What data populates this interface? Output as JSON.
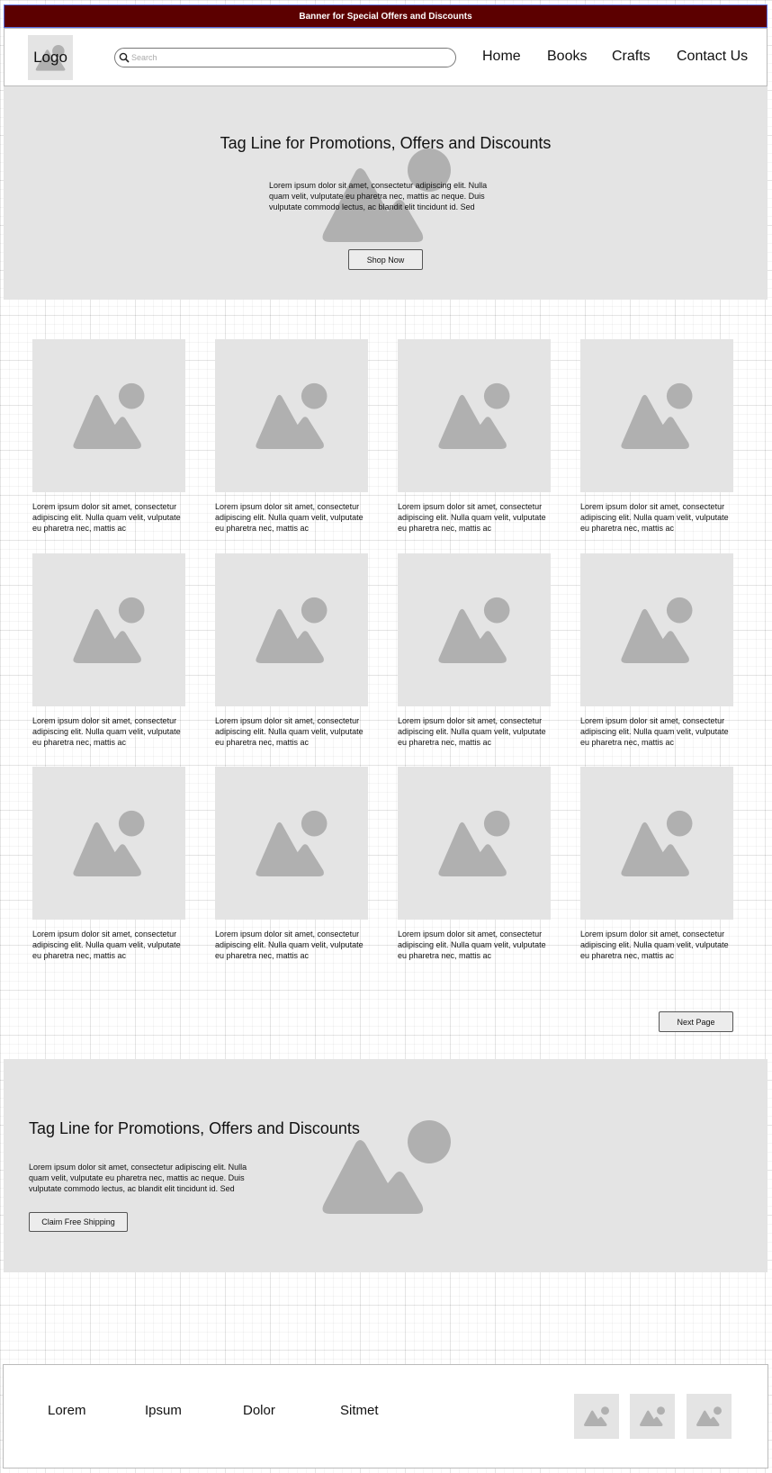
{
  "banner": {
    "text": "Banner for Special Offers and Discounts"
  },
  "header": {
    "logo": "Logo",
    "search": {
      "placeholder": "Search",
      "value": ""
    },
    "nav": [
      "Home",
      "Books",
      "Crafts",
      "Contact Us"
    ]
  },
  "hero": {
    "title": "Tag Line for Promotions, Offers and Discounts",
    "text": "Lorem ipsum dolor sit amet, consectetur adipiscing elit. Nulla quam velit, vulputate eu pharetra nec, mattis ac neque. Duis vulputate commodo lectus, ac blandit elit tincidunt id. Sed",
    "button": "Shop Now"
  },
  "products": [
    {
      "text": "Lorem ipsum dolor sit amet, consectetur adipiscing elit. Nulla quam velit, vulputate eu pharetra nec, mattis ac"
    },
    {
      "text": "Lorem ipsum dolor sit amet, consectetur adipiscing elit. Nulla quam velit, vulputate eu pharetra nec, mattis ac"
    },
    {
      "text": "Lorem ipsum dolor sit amet, consectetur adipiscing elit. Nulla quam velit, vulputate eu pharetra nec, mattis ac"
    },
    {
      "text": "Lorem ipsum dolor sit amet, consectetur adipiscing elit. Nulla quam velit, vulputate eu pharetra nec, mattis ac"
    },
    {
      "text": "Lorem ipsum dolor sit amet, consectetur adipiscing elit. Nulla quam velit, vulputate eu pharetra nec, mattis ac"
    },
    {
      "text": "Lorem ipsum dolor sit amet, consectetur adipiscing elit. Nulla quam velit, vulputate eu pharetra nec, mattis ac"
    },
    {
      "text": "Lorem ipsum dolor sit amet, consectetur adipiscing elit. Nulla quam velit, vulputate eu pharetra nec, mattis ac"
    },
    {
      "text": "Lorem ipsum dolor sit amet, consectetur adipiscing elit. Nulla quam velit, vulputate eu pharetra nec, mattis ac"
    },
    {
      "text": "Lorem ipsum dolor sit amet, consectetur adipiscing elit. Nulla quam velit, vulputate eu pharetra nec, mattis ac"
    },
    {
      "text": "Lorem ipsum dolor sit amet, consectetur adipiscing elit. Nulla quam velit, vulputate eu pharetra nec, mattis ac"
    },
    {
      "text": "Lorem ipsum dolor sit amet, consectetur adipiscing elit. Nulla quam velit, vulputate eu pharetra nec, mattis ac"
    },
    {
      "text": "Lorem ipsum dolor sit amet, consectetur adipiscing elit. Nulla quam velit, vulputate eu pharetra nec, mattis ac"
    }
  ],
  "pagination": {
    "next": "Next Page"
  },
  "promo": {
    "title": "Tag Line for Promotions, Offers and Discounts",
    "text": "Lorem ipsum dolor sit amet, consectetur adipiscing elit. Nulla quam velit, vulputate eu pharetra nec, mattis ac neque. Duis vulputate commodo lectus, ac blandit elit tincidunt id. Sed",
    "button": "Claim Free Shipping"
  },
  "footer": {
    "links": [
      "Lorem",
      "Ipsum",
      "Dolor",
      "Sitmet"
    ],
    "icons": [
      "image-placeholder-icon",
      "image-placeholder-icon",
      "image-placeholder-icon"
    ]
  },
  "colors": {
    "banner_bg": "#5c0000",
    "placeholder_bg": "#e4e4e4",
    "placeholder_icon": "#b0b0b0"
  }
}
